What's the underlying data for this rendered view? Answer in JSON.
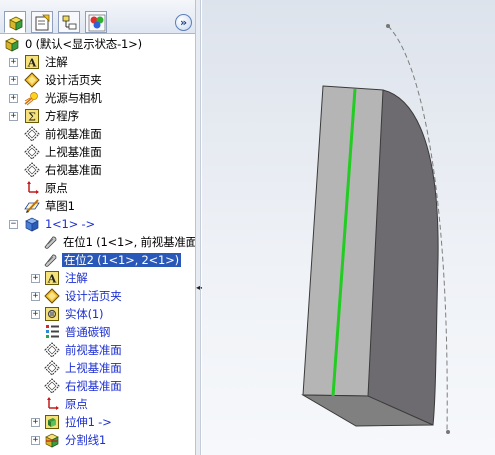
{
  "tabs": [
    {
      "name": "feature-manager-tab",
      "icon": "feature-tree-icon"
    },
    {
      "name": "property-manager-tab",
      "icon": "property-manager-icon"
    },
    {
      "name": "configuration-manager-tab",
      "icon": "configuration-icon"
    },
    {
      "name": "display-manager-tab",
      "icon": "display-manager-icon"
    }
  ],
  "collapse_label": "»",
  "tree": {
    "root": "0  (默认<显示状态-1>)",
    "annotations": "注解",
    "design_binder": "设计活页夹",
    "lights_cameras": "光源与相机",
    "equations": "方程序",
    "front_plane": "前视基准面",
    "top_plane": "上视基准面",
    "right_plane": "右视基准面",
    "origin": "原点",
    "sketch1": "草图1",
    "part": "1<1> ->",
    "mate1": "在位1  (1<1>, 前视基准面",
    "mate2": "在位2  (1<1>, 2<1>)",
    "sub_annotations": "注解",
    "sub_design_binder": "设计活页夹",
    "solid_bodies": "实体(1)",
    "material": "普通碳钢",
    "sub_front_plane": "前视基准面",
    "sub_top_plane": "上视基准面",
    "sub_right_plane": "右视基准面",
    "sub_origin": "原点",
    "extrude1": "拉伸1 ->",
    "split_line1": "分割线1"
  },
  "splitter_grip": "◂◂",
  "colors": {
    "selection": "#2a58b8",
    "part_text": "#1c2fd3",
    "edge_highlight": "#22cc22",
    "face_light": "#b5b5b5",
    "face_dark": "#6d6a70"
  }
}
